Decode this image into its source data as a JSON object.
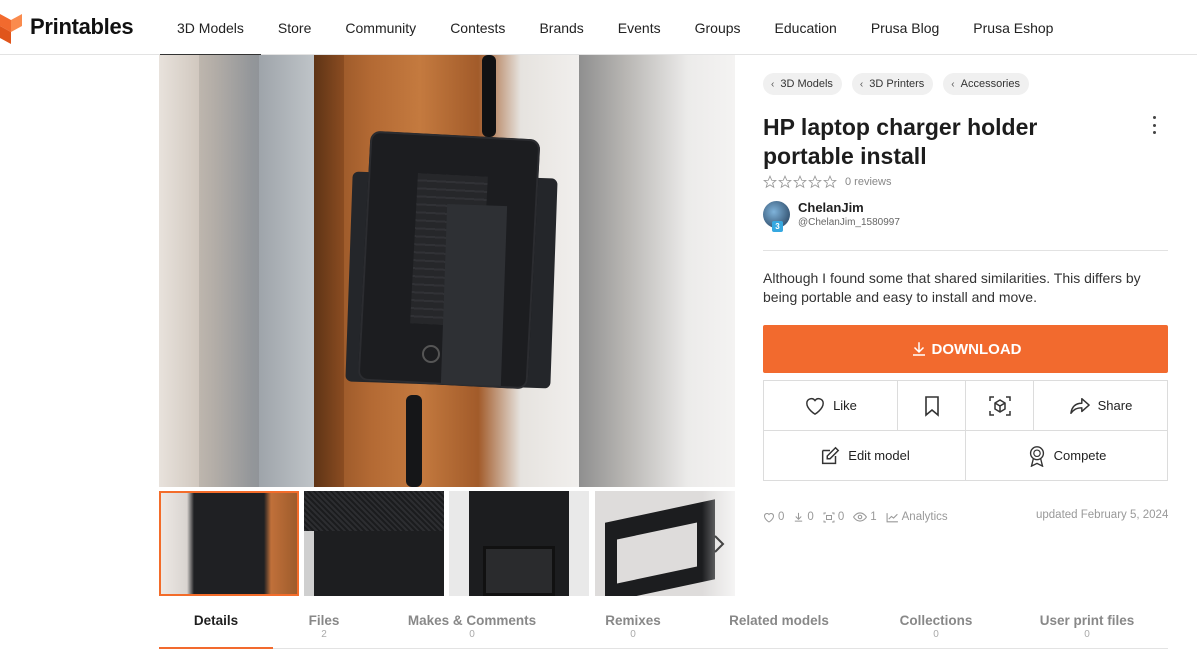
{
  "brand": {
    "name": "Printables",
    "accent": "#f26a2e"
  },
  "nav": {
    "items": [
      {
        "label": "3D Models",
        "active": true
      },
      {
        "label": "Store"
      },
      {
        "label": "Community"
      },
      {
        "label": "Contests"
      },
      {
        "label": "Brands"
      },
      {
        "label": "Events"
      },
      {
        "label": "Groups"
      },
      {
        "label": "Education"
      },
      {
        "label": "Prusa Blog"
      },
      {
        "label": "Prusa Eshop"
      }
    ]
  },
  "breadcrumb": [
    "3D Models",
    "3D Printers",
    "Accessories"
  ],
  "model": {
    "title": "HP laptop charger holder portable install",
    "rating_count": 0,
    "reviews_label": "0 reviews",
    "summary": "Although I found some that shared similarities. This differs by being portable and easy to install and move."
  },
  "author": {
    "name": "ChelanJim",
    "handle": "@ChelanJim_1580997",
    "level": "3"
  },
  "actions": {
    "download": "DOWNLOAD",
    "like": "Like",
    "share": "Share",
    "edit": "Edit model",
    "compete": "Compete"
  },
  "stats": {
    "likes": "0",
    "downloads": "0",
    "makes": "0",
    "views": "1",
    "analytics": "Analytics",
    "updated": "updated February 5, 2024"
  },
  "gallery": {
    "thumbnail_count": 4,
    "active_index": 0
  },
  "tabs": [
    {
      "label": "Details",
      "count": "",
      "active": true
    },
    {
      "label": "Files",
      "count": "2"
    },
    {
      "label": "Makes & Comments",
      "count": "0"
    },
    {
      "label": "Remixes",
      "count": "0"
    },
    {
      "label": "Related models",
      "count": ""
    },
    {
      "label": "Collections",
      "count": "0"
    },
    {
      "label": "User print files",
      "count": "0"
    }
  ]
}
